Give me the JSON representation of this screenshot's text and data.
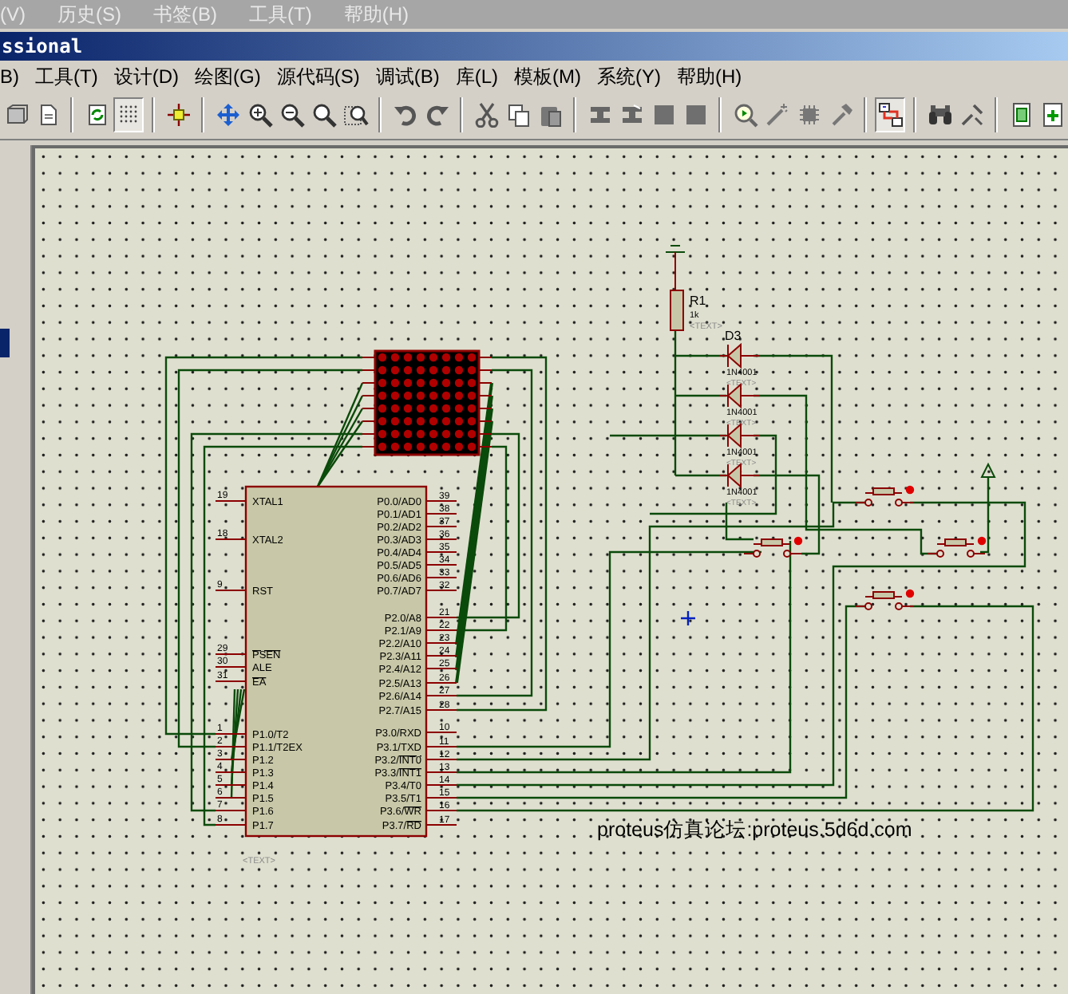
{
  "browser_menu": [
    "(V)",
    "历史(S)",
    "书签(B)",
    "工具(T)",
    "帮助(H)"
  ],
  "window": {
    "title": "ssional"
  },
  "menu": [
    "B)",
    "工具(T)",
    "设计(D)",
    "绘图(G)",
    "源代码(S)",
    "调试(B)",
    "库(L)",
    "模板(M)",
    "系统(Y)",
    "帮助(H)"
  ],
  "toolbar": [
    [
      {
        "kind": "cube",
        "selected": false
      },
      {
        "kind": "page",
        "selected": false
      }
    ],
    [
      {
        "kind": "refresh",
        "selected": false
      },
      {
        "kind": "grid",
        "selected": true
      }
    ],
    [
      {
        "kind": "origin",
        "selected": false
      }
    ],
    [
      {
        "kind": "pan",
        "selected": false
      },
      {
        "kind": "zoom-in",
        "selected": false
      },
      {
        "kind": "zoom-out",
        "selected": false
      },
      {
        "kind": "zoom",
        "selected": false
      },
      {
        "kind": "zoom-area",
        "selected": false
      }
    ],
    [
      {
        "kind": "undo",
        "selected": false
      },
      {
        "kind": "redo",
        "selected": false
      }
    ],
    [
      {
        "kind": "cut",
        "selected": false
      },
      {
        "kind": "copy",
        "selected": false
      },
      {
        "kind": "paste",
        "selected": false
      }
    ],
    [
      {
        "kind": "block-copy",
        "selected": false
      },
      {
        "kind": "block-move",
        "selected": false
      },
      {
        "kind": "block",
        "selected": false
      },
      {
        "kind": "block",
        "selected": false
      }
    ],
    [
      {
        "kind": "pick",
        "selected": false
      },
      {
        "kind": "wand",
        "selected": false
      },
      {
        "kind": "chip",
        "selected": false
      },
      {
        "kind": "hammer",
        "selected": false
      }
    ],
    [
      {
        "kind": "netlist",
        "selected": true
      }
    ],
    [
      {
        "kind": "binoculars",
        "selected": false
      },
      {
        "kind": "tools",
        "selected": false
      }
    ],
    [
      {
        "kind": "sheet",
        "selected": false
      },
      {
        "kind": "add-sheet",
        "selected": false
      }
    ]
  ],
  "schematic": {
    "chip": {
      "text": "<TEXT>",
      "left_pins": [
        {
          "number": "19",
          "label": "XTAL1"
        },
        {
          "number": "18",
          "label": "XTAL2"
        },
        {
          "number": "9",
          "label": "RST"
        },
        {
          "number": "29",
          "inverted": "PSEN"
        },
        {
          "number": "30",
          "label": "ALE"
        },
        {
          "number": "31",
          "inverted": "EA"
        },
        {
          "number": "1",
          "label": "P1.0/T2"
        },
        {
          "number": "2",
          "label": "P1.1/T2EX"
        },
        {
          "number": "3",
          "label": "P1.2"
        },
        {
          "number": "4",
          "label": "P1.3"
        },
        {
          "number": "5",
          "label": "P1.4"
        },
        {
          "number": "6",
          "label": "P1.5"
        },
        {
          "number": "7",
          "label": "P1.6"
        },
        {
          "number": "8",
          "label": "P1.7"
        }
      ],
      "right_pins": [
        {
          "number": "39",
          "label": "P0.0/AD0"
        },
        {
          "number": "38",
          "label": "P0.1/AD1"
        },
        {
          "number": "37",
          "label": "P0.2/AD2"
        },
        {
          "number": "36",
          "label": "P0.3/AD3"
        },
        {
          "number": "35",
          "label": "P0.4/AD4"
        },
        {
          "number": "34",
          "label": "P0.5/AD5"
        },
        {
          "number": "33",
          "label": "P0.6/AD6"
        },
        {
          "number": "32",
          "label": "P0.7/AD7"
        },
        {
          "number": "21",
          "label": "P2.0/A8"
        },
        {
          "number": "22",
          "label": "P2.1/A9"
        },
        {
          "number": "23",
          "label": "P2.2/A10"
        },
        {
          "number": "24",
          "label": "P2.3/A11"
        },
        {
          "number": "25",
          "label": "P2.4/A12"
        },
        {
          "number": "26",
          "label": "P2.5/A13"
        },
        {
          "number": "27",
          "label": "P2.6/A14"
        },
        {
          "number": "28",
          "label": "P2.7/A15"
        },
        {
          "number": "10",
          "label": "P3.0/RXD"
        },
        {
          "number": "11",
          "label": "P3.1/TXD"
        },
        {
          "number": "12",
          "label": "P3.2/",
          "inverted": "INT0"
        },
        {
          "number": "13",
          "label": "P3.3/",
          "inverted": "INT1"
        },
        {
          "number": "14",
          "label": "P3.4/T0"
        },
        {
          "number": "15",
          "label": "P3.5/T1"
        },
        {
          "number": "16",
          "label": "P3.6/",
          "inverted": "WR"
        },
        {
          "number": "17",
          "label": "P3.7/",
          "inverted": "RD"
        }
      ]
    },
    "resistor": {
      "ref": "R1",
      "value": "1k",
      "text": "<TEXT>"
    },
    "diodes": [
      {
        "ref": "D3",
        "value": "1N4001",
        "text": "<TEXT>"
      },
      {
        "value": "1N4001",
        "text": "<TEXT>"
      },
      {
        "value": "1N4001",
        "text": "<TEXT>"
      },
      {
        "value": "1N4001",
        "text": "<TEXT>"
      }
    ],
    "note": "proteus仿真论坛:proteus.5d6d.com"
  }
}
